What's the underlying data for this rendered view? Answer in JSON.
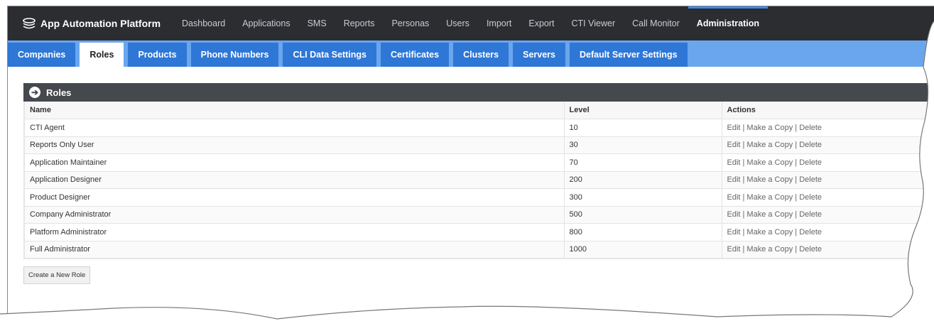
{
  "app": {
    "title": "App Automation Platform",
    "logo_icon": "cloud-stack-icon"
  },
  "topnav": {
    "items": [
      {
        "label": "Dashboard",
        "active": false
      },
      {
        "label": "Applications",
        "active": false
      },
      {
        "label": "SMS",
        "active": false
      },
      {
        "label": "Reports",
        "active": false
      },
      {
        "label": "Personas",
        "active": false
      },
      {
        "label": "Users",
        "active": false
      },
      {
        "label": "Import",
        "active": false
      },
      {
        "label": "Export",
        "active": false
      },
      {
        "label": "CTI Viewer",
        "active": false
      },
      {
        "label": "Call Monitor",
        "active": false
      },
      {
        "label": "Administration",
        "active": true
      }
    ]
  },
  "subtabs": {
    "items": [
      {
        "label": "Companies",
        "active": false
      },
      {
        "label": "Roles",
        "active": true
      },
      {
        "label": "Products",
        "active": false
      },
      {
        "label": "Phone Numbers",
        "active": false
      },
      {
        "label": "CLI Data Settings",
        "active": false
      },
      {
        "label": "Certificates",
        "active": false
      },
      {
        "label": "Clusters",
        "active": false
      },
      {
        "label": "Servers",
        "active": false
      },
      {
        "label": "Default Server Settings",
        "active": false
      }
    ]
  },
  "panel": {
    "title": "Roles",
    "icon": "arrow-circle-right-icon"
  },
  "table": {
    "headers": {
      "name": "Name",
      "level": "Level",
      "actions": "Actions"
    },
    "rows": [
      {
        "name": "CTI Agent",
        "level": "10",
        "actions": "Edit | Make a Copy | Delete"
      },
      {
        "name": "Reports Only User",
        "level": "30",
        "actions": "Edit | Make a Copy | Delete"
      },
      {
        "name": "Application Maintainer",
        "level": "70",
        "actions": "Edit | Make a Copy | Delete"
      },
      {
        "name": "Application Designer",
        "level": "200",
        "actions": "Edit | Make a Copy | Delete"
      },
      {
        "name": "Product Designer",
        "level": "300",
        "actions": "Edit | Make a Copy | Delete"
      },
      {
        "name": "Company Administrator",
        "level": "500",
        "actions": "Edit | Make a Copy | Delete"
      },
      {
        "name": "Platform Administrator",
        "level": "800",
        "actions": "Edit | Make a Copy | Delete"
      },
      {
        "name": "Full Administrator",
        "level": "1000",
        "actions": "Edit | Make a Copy | Delete"
      }
    ]
  },
  "buttons": {
    "create_role": "Create a New Role"
  },
  "colors": {
    "topnav_bg": "#2b2d31",
    "subtab_bar": "#6aa6ee",
    "subtab_bg": "#2e77d6",
    "panel_header": "#45484d"
  }
}
